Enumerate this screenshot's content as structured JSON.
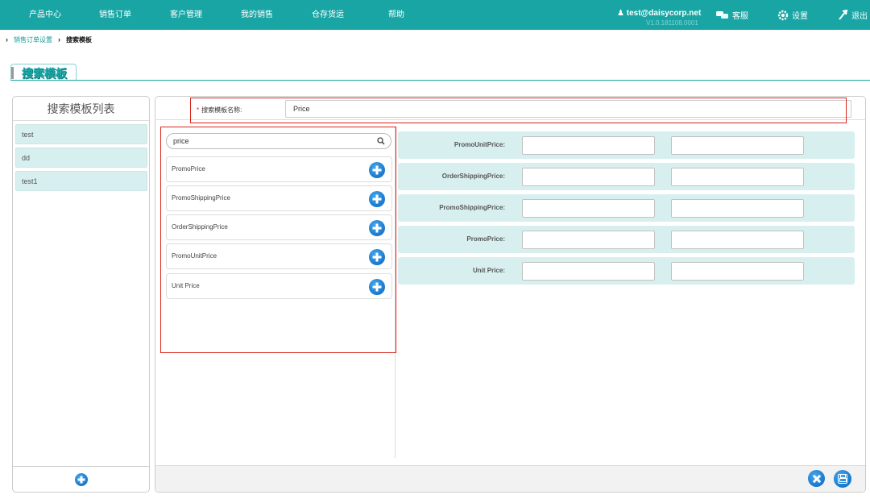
{
  "nav": {
    "items": [
      "产品中心",
      "销售订单",
      "客户管理",
      "我的销售",
      "仓存货运",
      "帮助"
    ]
  },
  "user": {
    "email": "test@daisycorp.net",
    "version": "V1.0.181108.0001"
  },
  "toolbar": {
    "service_label": "客服",
    "settings_label": "设置",
    "logout_label": "退出"
  },
  "breadcrumb": {
    "parent": "销售订单设置",
    "current": "搜索模板"
  },
  "page": {
    "title": "搜索模板"
  },
  "template_list": {
    "header": "搜索模板列表",
    "items": [
      "test",
      "dd",
      "test1"
    ]
  },
  "template_form": {
    "name_required_mark": "*",
    "name_label": "搜索模板名称:",
    "name_value": "Price"
  },
  "field_search": {
    "query": "price",
    "results": [
      "PromoPrice",
      "PromoShippingPrice",
      "OrderShippingPrice",
      "PromoUnitPrice",
      "Unit Price"
    ]
  },
  "selected_fields": [
    {
      "label": "PromoUnitPrice:",
      "value_a": "",
      "value_b": ""
    },
    {
      "label": "OrderShippingPrice:",
      "value_a": "",
      "value_b": ""
    },
    {
      "label": "PromoShippingPrice:",
      "value_a": "",
      "value_b": ""
    },
    {
      "label": "PromoPrice:",
      "value_a": "",
      "value_b": ""
    },
    {
      "label": "Unit Price:",
      "value_a": "",
      "value_b": ""
    }
  ],
  "colors": {
    "nav_bg": "#1aa5a5",
    "accent_blue": "#1d7ed1",
    "row_bg": "#d8eff0",
    "highlight_red": "#d9261c"
  }
}
